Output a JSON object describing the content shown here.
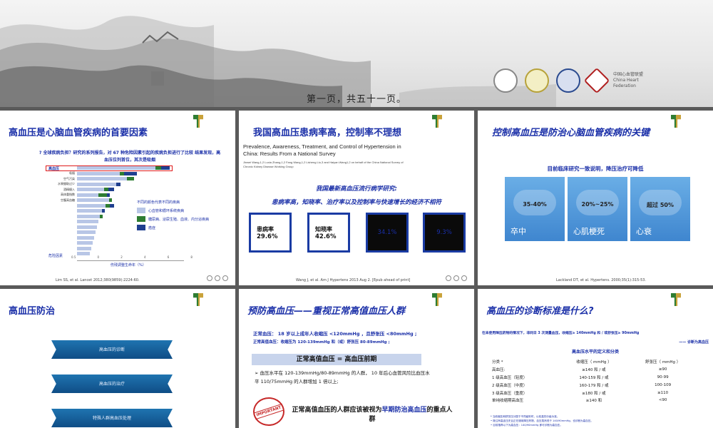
{
  "banner": {
    "caption": "第一页，共五十一页。",
    "logo_text": "中国心血管联盟 China Heart Federation"
  },
  "slide1": {
    "title": "高血压是心脑血管疾病的首要因素",
    "subtitle": "? 全球疾病负担？研究的系列报告，对 67 种危险因素引起的疾病负担进行了比较 结果发现，高血压位列首位，其次是吸烟",
    "first_factor": "高血压",
    "bar_labels": [
      "吸烟",
      "空气污染",
      "水果摄取过少",
      "酒精摄入",
      "高体重指数",
      "空腹高血糖",
      "",
      "",
      "",
      "",
      "",
      "",
      "",
      "",
      "",
      "",
      ""
    ],
    "legend_title": "不同的颜色代表不同的疾病",
    "legend": [
      {
        "label": "心血管和循环系统疾病",
        "color": "#b8c6e6"
      },
      {
        "label": "糖尿病、泌尿生殖、血液、内分泌疾病",
        "color": "#2e7d32"
      },
      {
        "label": "癌症",
        "color": "#1f3f8f"
      }
    ],
    "axis_ticks": [
      "0.5",
      "0",
      "2",
      "4",
      "6",
      "8"
    ],
    "axis_label": "伤残调整生命年（%）",
    "bottom_label": "危险因素",
    "reference": "Lim SS, et al. Lancet 2012;380(9859):2224-60."
  },
  "slide2": {
    "title": "我国高血压患病率高，控制率不理想",
    "paper_title": "Prevalence, Awareness, Treatment, and Control of Hypertension in China: Results From a National Survey",
    "paper_authors": "Jinwei Wang,1,2 Luxia Zhang,1,2 Fang Wang,1,2 Lisheng Liu,3 and Haiyan Wang1,2 on behalf of the China National Survey of Chronic Kidney Disease Working Group",
    "heading1": "我国最新高血压流行病学研究:",
    "heading2": "患病率高，知晓率、治疗率以及控制率与快速增长的经济不相符",
    "stats": [
      {
        "label": "患病率",
        "value": "29.6%"
      },
      {
        "label": "知晓率",
        "value": "42.6%"
      },
      {
        "label": "",
        "value": "34.1%"
      },
      {
        "label": "",
        "value": "9.3%"
      }
    ],
    "reference": "Wang J, et al. Am J Hypertens 2013 Aug 2. [Epub ahead of print]"
  },
  "slide3": {
    "title": "控制高血压是防治心脑血管疾病的关键",
    "subtitle": "目前临床研究一致说明，降压治疗可降低",
    "tiles": [
      {
        "pct": "35-40%",
        "name": "卒中"
      },
      {
        "pct": "20%~25%",
        "name": "心肌梗死"
      },
      {
        "pct": "超过 50%",
        "name": "心衰"
      }
    ],
    "reference": "Lackland DT, et al. Hypertens. 2000;35(1):315-53."
  },
  "slide4": {
    "title": "高血压防治",
    "ribbons": [
      "高血压的诊断",
      "高血压的治疗",
      "特殊人群高血压处理"
    ]
  },
  "slide5": {
    "title": "预防高血压——重视正常高值血压人群",
    "line1": "正常血压： 18 岁以上成年人收缩压 <120mmHg ，且舒张压 <80mmHg ;",
    "line2": "正常高值血压：收缩压为 120-139mmHg 和（或）舒张压 80-89mmHg ;",
    "bar": "正常高值血压 = 高血压前期",
    "bullet": "血压水平在 120-139mmHg/80-89mmHg 的人群， 10 年后心血管风险比血压水平 110/75mmHg 的人群增加 1 倍以上;",
    "stamp": "IMPORTANT",
    "big_pre": "正常高值血压的人群应该被视为",
    "big_em": "早期防治高血压",
    "big_post": "的重点人群"
  },
  "slide6": {
    "title": "高血压的诊断标准是什么?",
    "intro": "在未使用降压药物的情况下，非同日 3 次测量血压，收缩压≥ 140mmHg 和 / 或舒张压≥ 90mmHg",
    "source": "—— 诊断为高血压",
    "table_title": "高血压水平的定义和分类",
    "rows": [
      [
        "分类 *",
        "收缩压（ mmHg ）",
        "舒张压（ mmHg ）"
      ],
      [
        "高血压:",
        "≥140 和 / 或",
        "≥90"
      ],
      [
        "1 级高血压（轻度）",
        "140-159 和 / 或",
        "90-99"
      ],
      [
        "2 级高血压（中度）",
        "160-179 和 / 或",
        "100-109"
      ],
      [
        "3 级高血压（重度）",
        "≥180 和 / 或",
        "≥110"
      ],
      [
        "单纯收缩期高血压",
        "≥140 和",
        "<90"
      ]
    ],
    "note1": "* 当收缩压和舒张压分属于不同级别时，以较高的分级为准。",
    "note2": "• 既往有高血压史且正在服用降压药物，血压虽然低于 140/90mmHg，也诊断为高血压。",
    "note3": "• 目前推荐以下为高血压：140/90mmHg 即可诊断为高血压。"
  }
}
